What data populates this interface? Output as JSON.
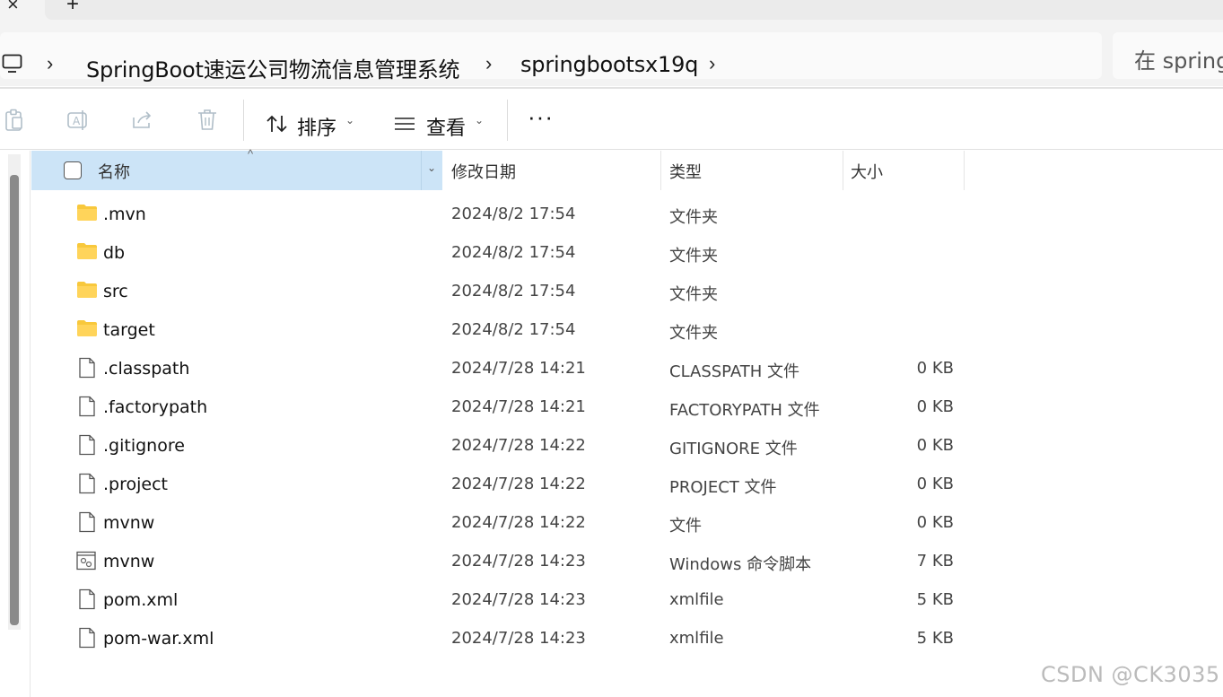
{
  "tabstrip": {
    "close_label": "×",
    "new_tab_label": "+"
  },
  "address": {
    "separator": "›",
    "crumbs": [
      "SpringBoot速运公司物流信息管理系统",
      "springbootsx19q"
    ],
    "search_placeholder": "在 spring"
  },
  "toolbar": {
    "sort_label": "排序",
    "view_label": "查看",
    "more_label": "···",
    "caret": "⌄"
  },
  "columns": {
    "name": "名称",
    "modified": "修改日期",
    "type": "类型",
    "size": "大小",
    "sort_arrow": "^",
    "drop": "⌄"
  },
  "files": [
    {
      "name": ".mvn",
      "modified": "2024/8/2 17:54",
      "type": "文件夹",
      "size": "",
      "kind": "folder"
    },
    {
      "name": "db",
      "modified": "2024/8/2 17:54",
      "type": "文件夹",
      "size": "",
      "kind": "folder"
    },
    {
      "name": "src",
      "modified": "2024/8/2 17:54",
      "type": "文件夹",
      "size": "",
      "kind": "folder"
    },
    {
      "name": "target",
      "modified": "2024/8/2 17:54",
      "type": "文件夹",
      "size": "",
      "kind": "folder"
    },
    {
      "name": ".classpath",
      "modified": "2024/7/28 14:21",
      "type": "CLASSPATH 文件",
      "size": "0 KB",
      "kind": "file"
    },
    {
      "name": ".factorypath",
      "modified": "2024/7/28 14:21",
      "type": "FACTORYPATH 文件",
      "size": "0 KB",
      "kind": "file"
    },
    {
      "name": ".gitignore",
      "modified": "2024/7/28 14:22",
      "type": "GITIGNORE 文件",
      "size": "0 KB",
      "kind": "file"
    },
    {
      "name": ".project",
      "modified": "2024/7/28 14:22",
      "type": "PROJECT 文件",
      "size": "0 KB",
      "kind": "file"
    },
    {
      "name": "mvnw",
      "modified": "2024/7/28 14:22",
      "type": "文件",
      "size": "0 KB",
      "kind": "file"
    },
    {
      "name": "mvnw",
      "modified": "2024/7/28 14:23",
      "type": "Windows 命令脚本",
      "size": "7 KB",
      "kind": "script"
    },
    {
      "name": "pom.xml",
      "modified": "2024/7/28 14:23",
      "type": "xmlfile",
      "size": "5 KB",
      "kind": "file"
    },
    {
      "name": "pom-war.xml",
      "modified": "2024/7/28 14:23",
      "type": "xmlfile",
      "size": "5 KB",
      "kind": "file"
    }
  ],
  "watermark": "CSDN @CK3035",
  "colors": {
    "header_selected": "#cce4f7",
    "folder": "#f8c83c"
  }
}
